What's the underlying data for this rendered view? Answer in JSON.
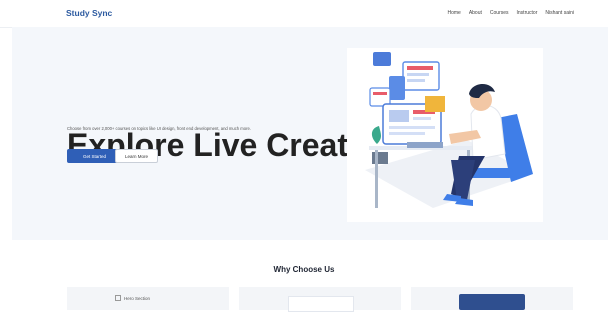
{
  "nav": {
    "brand": "Study Sync",
    "links": [
      "Home",
      "About",
      "Courses",
      "Instructor",
      "Nishant saini"
    ]
  },
  "hero": {
    "title": "Explore Live Creative Classes",
    "subtitle": "Choose from over 2,000+ courses on topics like UI design, front end development, and much more.",
    "primary_button": "Get Started",
    "secondary_button": "Learn More"
  },
  "why": {
    "title": "Why Choose Us",
    "cards": [
      {
        "alt": "Hero Section"
      },
      {},
      {}
    ]
  },
  "colors": {
    "brand": "#2c5aa0",
    "primary_button": "#2f5fb7",
    "hero_bg": "#f4f7fb"
  }
}
